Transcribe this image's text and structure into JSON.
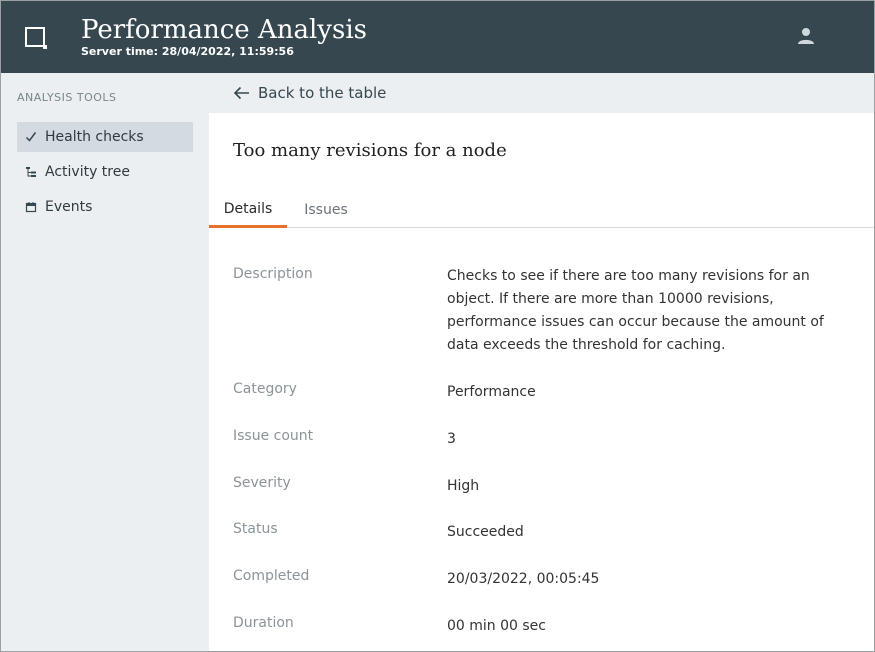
{
  "header": {
    "title": "Performance Analysis",
    "server_time": "Server time: 28/04/2022, 11:59:56",
    "bg_color": "#37474f",
    "user_icon": "user-icon"
  },
  "sidebar": {
    "heading": "ANALYSIS TOOLS",
    "items": [
      {
        "label": "Health checks",
        "icon": "check-icon",
        "active": true
      },
      {
        "label": "Activity tree",
        "icon": "tree-icon",
        "active": false
      },
      {
        "label": "Events",
        "icon": "calendar-icon",
        "active": false
      }
    ]
  },
  "main": {
    "back_label": "Back to the table",
    "title": "Too many revisions for a node",
    "tabs": [
      {
        "label": "Details",
        "active": true
      },
      {
        "label": "Issues",
        "active": false
      }
    ],
    "accent_color": "#e8712a",
    "details": [
      {
        "label": "Description",
        "value": "Checks to see if there are too many revisions for an object. If there are more than 10000 revisions, performance issues can occur because the amount of data exceeds the threshold for caching."
      },
      {
        "label": "Category",
        "value": "Performance"
      },
      {
        "label": "Issue count",
        "value": "3"
      },
      {
        "label": "Severity",
        "value": "High"
      },
      {
        "label": "Status",
        "value": "Succeeded"
      },
      {
        "label": "Completed",
        "value": "20/03/2022, 00:05:45"
      },
      {
        "label": "Duration",
        "value": "00 min 00 sec"
      }
    ]
  }
}
